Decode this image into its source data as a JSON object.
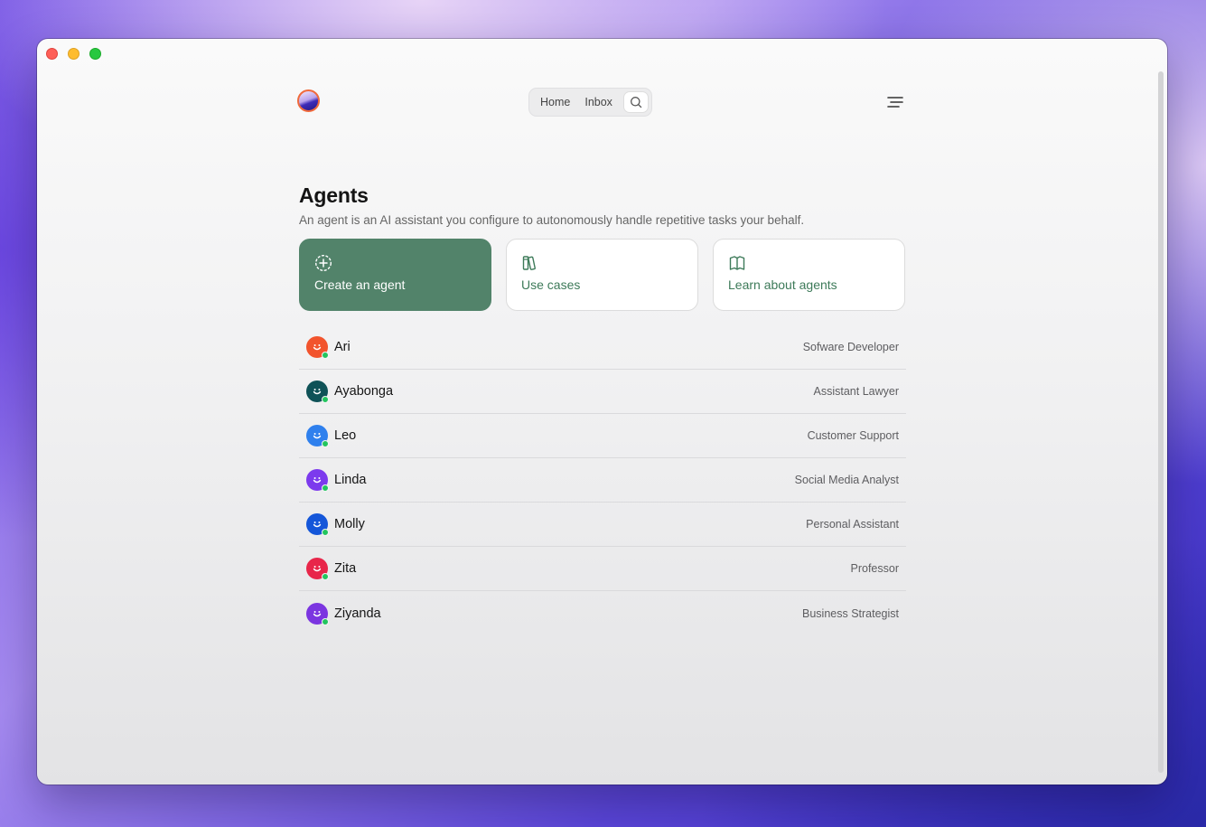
{
  "nav": {
    "home": "Home",
    "inbox": "Inbox"
  },
  "page": {
    "title": "Agents",
    "subtitle": "An agent is an AI assistant you configure to autonomously handle repetitive tasks your behalf."
  },
  "cards": {
    "create": "Create an agent",
    "use_cases": "Use cases",
    "learn": "Learn about agents"
  },
  "agents": [
    {
      "name": "Ari",
      "role": "Sofware Developer",
      "color": "#f2542d"
    },
    {
      "name": "Ayabonga",
      "role": "Assistant Lawyer",
      "color": "#0f5257"
    },
    {
      "name": "Leo",
      "role": "Customer Support",
      "color": "#2f80ed"
    },
    {
      "name": "Linda",
      "role": "Social Media Analyst",
      "color": "#7c3aed"
    },
    {
      "name": "Molly",
      "role": "Personal Assistant",
      "color": "#1456d9"
    },
    {
      "name": "Zita",
      "role": "Professor",
      "color": "#e8264a"
    },
    {
      "name": "Ziyanda",
      "role": "Business Strategist",
      "color": "#7b35e0"
    }
  ],
  "icons": {
    "logo": "app-logo",
    "search": "search-icon",
    "menu": "menu-icon",
    "create": "plus-circle-icon",
    "use_cases": "books-icon",
    "learn": "open-book-icon",
    "agent": "smiley-icon"
  },
  "colors": {
    "accent": "#52836a",
    "accent_text": "#3d7a59",
    "online": "#22c55e"
  }
}
